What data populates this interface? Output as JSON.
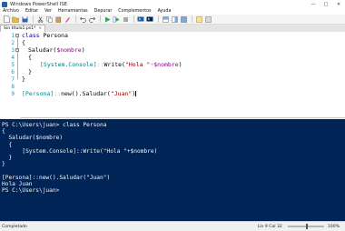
{
  "window": {
    "title": "Windows PowerShell ISE"
  },
  "menu": [
    "Archivo",
    "Editar",
    "Ver",
    "Herramientas",
    "Depurar",
    "Complementos",
    "Ayuda"
  ],
  "tab": {
    "label": "Sin título1.ps1*",
    "close": "×"
  },
  "editor": {
    "line_numbers": [
      "1",
      "2",
      "3",
      "4",
      "5",
      "6",
      "7",
      "8",
      "9"
    ],
    "fold_glyphs": [
      "−",
      "−"
    ],
    "lines": {
      "l1_kw": "class",
      "l1_name": " Persona",
      "l2": "{",
      "l3_fn": "Saludar(",
      "l3_var": "$nombre",
      "l3_close": ")",
      "l4": "{",
      "l5_type": "[System.Console]",
      "l5_op": "::",
      "l5_fn": "Write(",
      "l5_str": "\"Hola \"",
      "l5_plus": "+",
      "l5_var": "$nombre",
      "l5_close": ")",
      "l6": "}",
      "l7": "}",
      "l9_type": "[Persona]",
      "l9_op": "::",
      "l9_fn": "new().Saludar(",
      "l9_str": "\"Juan\"",
      "l9_close": ")"
    }
  },
  "console": {
    "lines": [
      "PS C:\\Users\\juan> class Persona",
      "{",
      "  Saludar($nombre)",
      "  {",
      "      [System.Console]::Write(\"Hola \"+$nombre)",
      "  }",
      "}",
      "",
      "[Persona]::new().Saludar(\"Juan\")",
      "Hola Juan",
      "PS C:\\Users\\juan>"
    ]
  },
  "status": {
    "text": "Completado",
    "position": "Lín 9  Col 32",
    "zoom": "100%",
    "zoom_level_percent": 100
  },
  "colors": {
    "console_bg": "#012456",
    "keyword": "#00008b",
    "variable": "#8b008b",
    "type": "#008080",
    "string": "#8b0000"
  }
}
